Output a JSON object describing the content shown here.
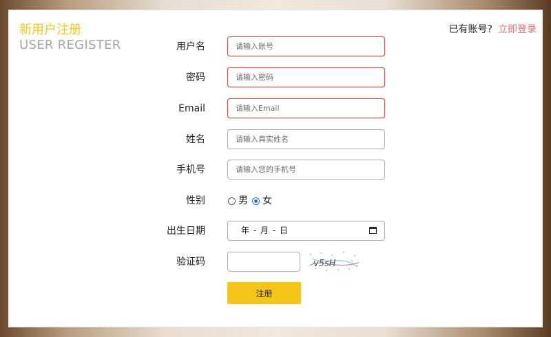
{
  "header": {
    "title_cn": "新用户注册",
    "title_en": "USER REGISTER",
    "login_prompt": "已有账号?",
    "login_link": "立即登录"
  },
  "form": {
    "username": {
      "label": "用户名",
      "placeholder": "请输入账号"
    },
    "password": {
      "label": "密码",
      "placeholder": "请输入密码"
    },
    "email": {
      "label": "Email",
      "placeholder": "请输入Email"
    },
    "realname": {
      "label": "姓名",
      "placeholder": "请输入真实姓名"
    },
    "phone": {
      "label": "手机号",
      "placeholder": "请输入您的手机号"
    },
    "gender": {
      "label": "性别",
      "options": [
        "男",
        "女"
      ],
      "selected": "女"
    },
    "birthday": {
      "label": "出生日期",
      "display": "年 - 月 - 日"
    },
    "captcha": {
      "label": "验证码",
      "image_text": "v5sH"
    },
    "submit_label": "注册"
  },
  "colors": {
    "accent": "#f5c518",
    "error_border": "#e04646",
    "link": "#f07070"
  }
}
